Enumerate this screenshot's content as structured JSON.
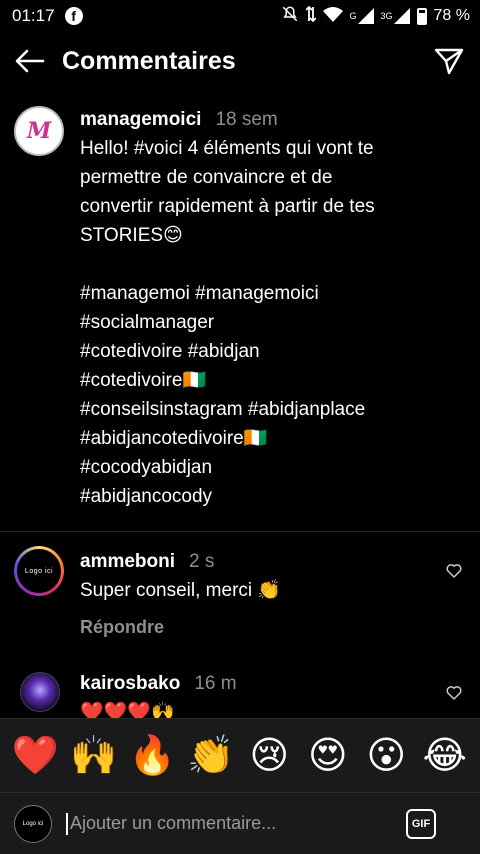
{
  "status_bar": {
    "time": "01:17",
    "network": "G",
    "network2": "3G",
    "battery": "78 %"
  },
  "header": {
    "title": "Commentaires"
  },
  "caption": {
    "username": "managemoici",
    "timestamp": "18 sem",
    "text_lines": [
      "Hello! #voici 4 éléments qui vont te",
      "permettre de convaincre et de",
      "convertir rapidement à partir de tes",
      "STORIES😊",
      "",
      "#managemoi #managemoici",
      "#socialmanager",
      "#cotedivoire #abidjan",
      "#cotedivoire🇨🇮",
      "#conseilsinstagram #abidjanplace",
      "#abidjancotedivoire🇨🇮",
      "#cocodyabidjan",
      "#abidjancocody"
    ]
  },
  "comments": [
    {
      "username": "ammeboni",
      "timestamp": "2 s",
      "text": "Super conseil, merci 👏",
      "reply_label": "Répondre",
      "avatar_text": "Logo ici"
    },
    {
      "username": "kairosbako",
      "timestamp": "16 m",
      "text": "❤️❤️❤️🙌"
    }
  ],
  "emoji_bar": [
    "❤️",
    "🙌",
    "🔥",
    "👏",
    "😢",
    "😍",
    "😮",
    "😂"
  ],
  "input": {
    "placeholder": "Ajouter un commentaire...",
    "gif_label": "GIF",
    "avatar_text": "Logo ici"
  },
  "colors": {
    "background": "#000000",
    "muted": "#8e8e8e",
    "panel": "#1a1a1a"
  }
}
